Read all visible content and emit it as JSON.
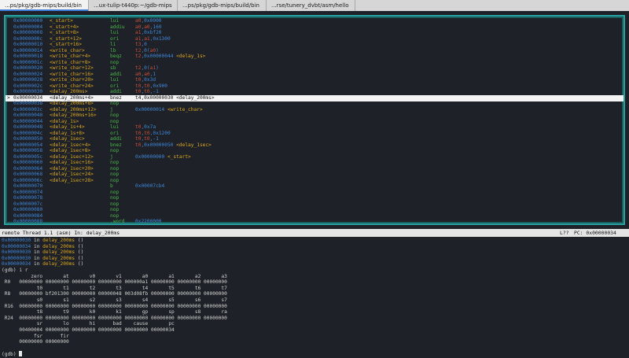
{
  "tabs": [
    {
      "label": "...ps/pkg/gdb-mips/build/bin",
      "active": true
    },
    {
      "label": "...ux-tulip-t440p:~/gdb-mips",
      "active": false
    },
    {
      "label": "...ps/pkg/gdb-mips/build/bin",
      "active": false
    },
    {
      "label": "...rse/tunery_dvbt/asm/hello",
      "active": false
    }
  ],
  "asm_rows": [
    {
      "addr": "0x00000000",
      "sym": "<_start>",
      "mn": "lui",
      "op": "a0,0x0000"
    },
    {
      "addr": "0x00000004",
      "sym": "<_start+4>",
      "mn": "addiu",
      "op": "a0,a0,160"
    },
    {
      "addr": "0x00000008",
      "sym": "<_start+8>",
      "mn": "lui",
      "op": "a1,0xbf20"
    },
    {
      "addr": "0x0000000c",
      "sym": "<_start+12>",
      "mn": "ori",
      "op": "a1,a1,0x1300"
    },
    {
      "addr": "0x00000010",
      "sym": "<_start+16>",
      "mn": "li",
      "op": "t3,0"
    },
    {
      "addr": "0x00000014",
      "sym": "<write_char>",
      "mn": "lb",
      "op": "t2,0(a0)"
    },
    {
      "addr": "0x00000018",
      "sym": "<write_char+4>",
      "mn": "beqz",
      "op": "t2,0x00000044 <delay_1s>"
    },
    {
      "addr": "0x0000001c",
      "sym": "<write_char+8>",
      "mn": "nop",
      "op": ""
    },
    {
      "addr": "0x00000020",
      "sym": "<write_char+12>",
      "mn": "sb",
      "op": "t2,0(a1)"
    },
    {
      "addr": "0x00000024",
      "sym": "<write_char+16>",
      "mn": "addi",
      "op": "a0,a0,1"
    },
    {
      "addr": "0x00000028",
      "sym": "<write_char+20>",
      "mn": "lui",
      "op": "t0,0x3d"
    },
    {
      "addr": "0x0000002c",
      "sym": "<write_char+24>",
      "mn": "ori",
      "op": "t0,t0,0x900"
    },
    {
      "addr": "0x00000030",
      "sym": "<delay_200ms>",
      "mn": "addi",
      "op": "t0,t0,-1"
    },
    {
      "addr": "0x00000034",
      "sym": "<delay_200ms+4>",
      "mn": "bnez",
      "op": "t4,0x00000030 <delay_200ms>",
      "current": true
    },
    {
      "addr": "0x00000038",
      "sym": "<delay_200ms+8>",
      "mn": "nop",
      "op": ""
    },
    {
      "addr": "0x0000003c",
      "sym": "<delay_200ms+12>",
      "mn": "j",
      "op": "0x00000014 <write_char>"
    },
    {
      "addr": "0x00000040",
      "sym": "<delay_200ms+16>",
      "mn": "nop",
      "op": ""
    },
    {
      "addr": "0x00000044",
      "sym": "<delay_1s>",
      "mn": "nop",
      "op": ""
    },
    {
      "addr": "0x00000048",
      "sym": "<delay_1s+4>",
      "mn": "lui",
      "op": "t0,0x7a"
    },
    {
      "addr": "0x0000004c",
      "sym": "<delay_1s+8>",
      "mn": "ori",
      "op": "t0,t0,0x1200"
    },
    {
      "addr": "0x00000050",
      "sym": "<delay_1sec>",
      "mn": "addi",
      "op": "t0,t0,-1"
    },
    {
      "addr": "0x00000054",
      "sym": "<delay_1sec+4>",
      "mn": "bnez",
      "op": "t0,0x00000050 <delay_1sec>"
    },
    {
      "addr": "0x00000058",
      "sym": "<delay_1sec+8>",
      "mn": "nop",
      "op": ""
    },
    {
      "addr": "0x0000005c",
      "sym": "<delay_1sec+12>",
      "mn": "j",
      "op": "0x00000000 <_start>"
    },
    {
      "addr": "0x00000060",
      "sym": "<delay_1sec+16>",
      "mn": "nop",
      "op": ""
    },
    {
      "addr": "0x00000064",
      "sym": "<delay_1sec+20>",
      "mn": "nop",
      "op": ""
    },
    {
      "addr": "0x00000068",
      "sym": "<delay_1sec+24>",
      "mn": "nop",
      "op": ""
    },
    {
      "addr": "0x0000006c",
      "sym": "<delay_1sec+28>",
      "mn": "nop",
      "op": ""
    },
    {
      "addr": "0x00000070",
      "sym": "",
      "mn": "b",
      "op": "0x00007cb4"
    },
    {
      "addr": "0x00000074",
      "sym": "",
      "mn": "nop",
      "op": ""
    },
    {
      "addr": "0x00000078",
      "sym": "",
      "mn": "nop",
      "op": ""
    },
    {
      "addr": "0x0000007c",
      "sym": "",
      "mn": "nop",
      "op": ""
    },
    {
      "addr": "0x00000080",
      "sym": "",
      "mn": "nop",
      "op": ""
    },
    {
      "addr": "0x00000084",
      "sym": "",
      "mn": "nop",
      "op": ""
    },
    {
      "addr": "0x00000088",
      "sym": "",
      "mn": ".word",
      "op": "0x2200000"
    }
  ],
  "status": {
    "thread": "remote Thread 1.1 (asm) In: delay_200ms",
    "line": "L??",
    "pc": "PC: 0x00000034"
  },
  "backtrace_lines": [
    {
      "addr": "0x00000030",
      "text": " in ",
      "fn": "delay_200ms",
      "tail": " ()"
    },
    {
      "addr": "0x00000034",
      "text": " in ",
      "fn": "delay_200ms",
      "tail": " ()"
    },
    {
      "addr": "0x00000030",
      "text": " in ",
      "fn": "delay_200ms",
      "tail": " ()"
    },
    {
      "addr": "0x00000030",
      "text": " in ",
      "fn": "delay_200ms",
      "tail": " ()"
    },
    {
      "addr": "0x00000034",
      "text": " in ",
      "fn": "delay_200ms",
      "tail": " ()"
    }
  ],
  "register_dump": [
    "(gdb) i r",
    "          zero       at       v0       v1       a0       a1       a2       a3",
    " R0   00000000 00000000 00000000 00000000 000000a1 00000000 00000000 00000000",
    "            t0       t1       t2       t3       t4       t5       t6       t7",
    " R8   00000000 bf201300 00000000 00000048 003d08fb 00000000 00000000 00000000",
    "            s0       s1       s2       s3       s4       s5       s6       s7",
    " R16  00000000 00000000 00000000 00000000 00000000 00000000 00000000 00000000",
    "            t8       t9       k0       k1       gp       sp       s8       ra",
    " R24  00000000 00000000 00000000 00000000 00000000 00000000 00000000 00000000",
    "            sr       lo       hi      bad    cause       pc",
    "      00400004 00000000 00000000 00000000 00000000 00000034",
    "           fsr      fir",
    "      00000000 00000000"
  ],
  "prompt": "(gdb) ",
  "colors": {
    "address": "#3f86d8",
    "function": "#d8a520",
    "mnemonic": "#4bb84b",
    "register": "#c8503a",
    "frame": "#2aa1a1"
  }
}
